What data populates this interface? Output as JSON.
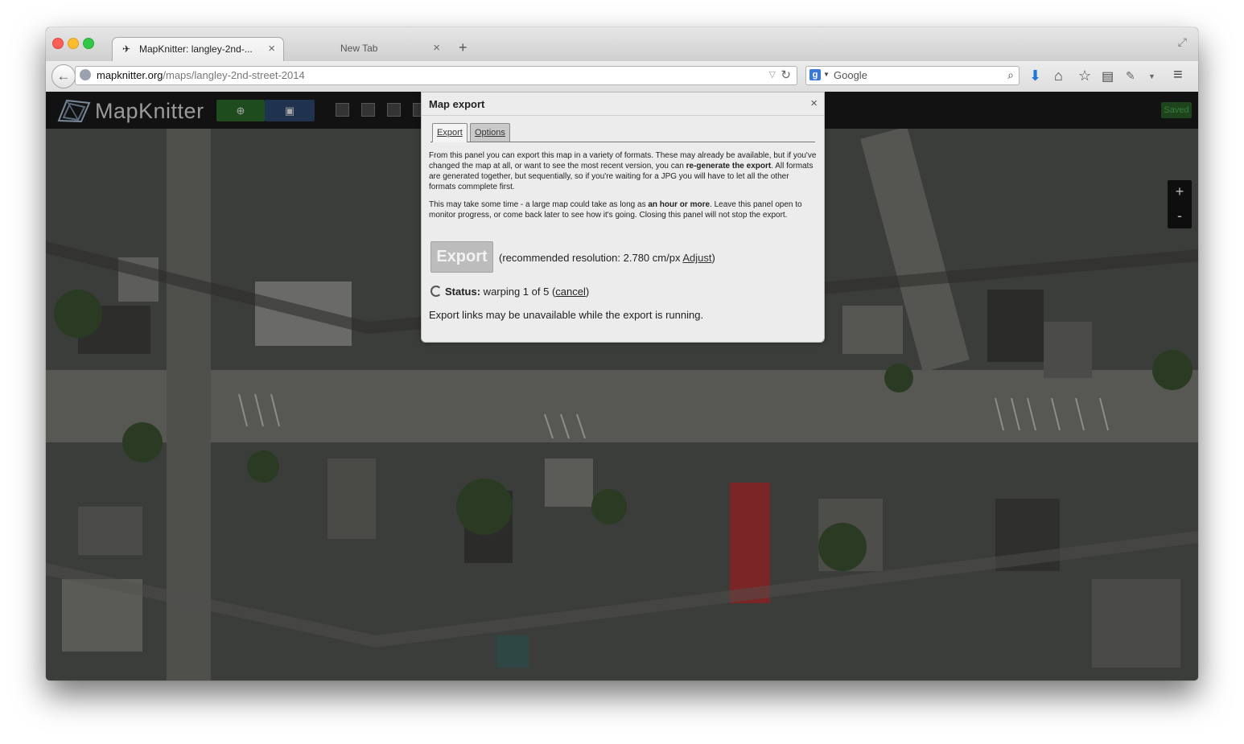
{
  "browser": {
    "tabs": [
      {
        "label": "MapKnitter: langley-2nd-...",
        "favicon": "mapknitter-favicon",
        "active": true
      },
      {
        "label": "New Tab",
        "active": false
      }
    ],
    "new_tab_symbol": "+",
    "close_symbol": "×",
    "url": {
      "host": "mapknitter.org",
      "path": "/maps/langley-2nd-street-2014"
    },
    "search": {
      "engine_letter": "g",
      "placeholder": "Google"
    },
    "icons": [
      "back-icon",
      "globe-icon",
      "reload-icon",
      "google-icon",
      "search-icon",
      "download-icon",
      "home-icon",
      "bookmark-star-icon",
      "reading-list-icon",
      "addon-icon",
      "menu-icon"
    ]
  },
  "app": {
    "logo_text": "MapKnitter",
    "saved_label": "Saved",
    "zoom_in": "+",
    "zoom_out": "-",
    "colors": {
      "toolbar_bg": "#121212",
      "green_button": "#1f4c1f",
      "blue_button": "#1f334f",
      "saved_bg": "#1d441d"
    }
  },
  "modal": {
    "title": "Map export",
    "close": "×",
    "tabs": {
      "export": "Export",
      "options": "Options"
    },
    "p1": {
      "a": "From this panel you can export this map in a variety of formats. These may already be available, but if you've changed the map at all, or want to see the most recent version, you can ",
      "b": "re-generate the export",
      "c": ". All formats are generated together, but sequentially, so if you're waiting for a JPG you will have to let all the other formats commplete first."
    },
    "p2": {
      "a": "This may take some time - a large map could take as long as ",
      "b": "an hour or more",
      "c": ". Leave this panel open to monitor progress, or come back later to see how it's going. Closing this panel will not stop the export."
    },
    "export_button": "Export",
    "resolution": {
      "prefix": "(recommended resolution: 2.780 cm/px ",
      "link": "Adjust",
      "suffix": ")"
    },
    "status": {
      "label": "Status:",
      "text": " warping 1 of 5 (",
      "cancel": "cancel",
      "end": ")"
    },
    "note": "Export links may be unavailable while the export is running."
  }
}
